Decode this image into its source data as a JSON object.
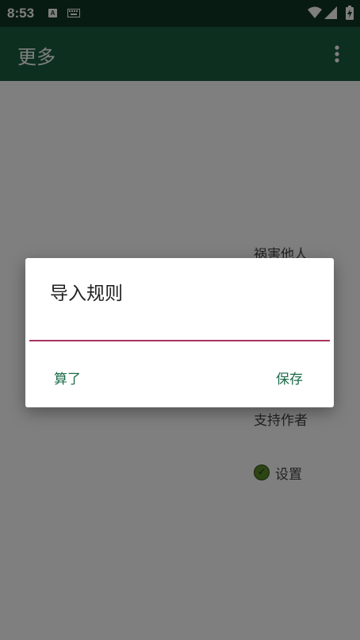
{
  "status_bar": {
    "time": "8:53",
    "a_icon_letter": "A"
  },
  "app_bar": {
    "title": "更多"
  },
  "menu": {
    "item_harm": "祸害他人",
    "item_support": "支持作者",
    "item_settings": "设置"
  },
  "dialog": {
    "title": "导入规则",
    "input_value": "",
    "cancel_label": "算了",
    "save_label": "保存"
  },
  "colors": {
    "status_bar": "#113625",
    "app_bar": "#1b5e40",
    "accent": "#a8325f",
    "button_text": "#1b6b4a"
  }
}
